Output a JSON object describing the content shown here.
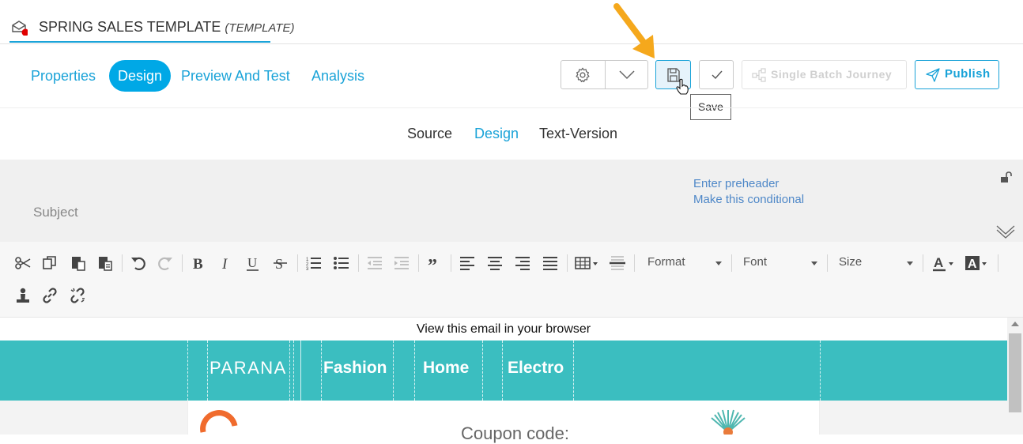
{
  "header": {
    "title": "SPRING SALES TEMPLATE",
    "title_suffix": "(TEMPLATE)"
  },
  "main_tabs": [
    {
      "label": "Properties",
      "active": false
    },
    {
      "label": "Design",
      "active": true
    },
    {
      "label": "Preview And Test",
      "active": false
    },
    {
      "label": "Analysis",
      "active": false
    }
  ],
  "toolbar": {
    "journey_label": "Single Batch Journey",
    "publish_label": "Publish",
    "save_tooltip": "Save"
  },
  "sub_tabs": [
    {
      "label": "Source",
      "active": false
    },
    {
      "label": "Design",
      "active": true
    },
    {
      "label": "Text-Version",
      "active": false
    }
  ],
  "subject": {
    "label": "Subject",
    "preheader_link": "Enter preheader",
    "conditional_link": "Make this conditional"
  },
  "editor": {
    "format_label": "Format",
    "font_label": "Font",
    "size_label": "Size"
  },
  "email": {
    "view_in_browser": "View this email in your browser",
    "logo_text": "PARANA",
    "nav": [
      "Fashion",
      "Home",
      "Electro"
    ],
    "coupon_partial": "Coupon code:"
  },
  "colors": {
    "accent": "#1aa3d8",
    "active_tab": "#00a8e6",
    "email_header": "#3bbec0",
    "arrow": "#f5a81c"
  }
}
